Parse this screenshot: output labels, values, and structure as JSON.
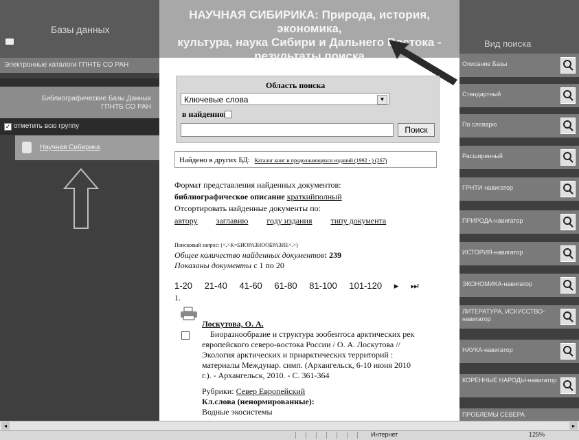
{
  "left": {
    "title": "Базы данных",
    "catalogs_link": "Электронные каталоги ГПНТБ СО РАН",
    "bibl_line1": "Библиографические Базы Данных",
    "bibl_line2": "ГПНТБ СО РАН",
    "group_label": "отметить всю группу",
    "db_item": "Научная Сибирика"
  },
  "header": {
    "line1": "НАУЧНАЯ СИБИРИКА: Природа, история, экономика,",
    "line2": "культура, наука Сибири и Дальнего Востока -",
    "line3": "результаты поиска"
  },
  "search": {
    "area_label": "Область поиска",
    "field_value": "Ключевые слова",
    "in_found_label": "в найденном",
    "query_value": "",
    "button": "Поиск"
  },
  "found_other": {
    "label": "Найдено в других БД:",
    "link": "Каталог книг и продолжающихся изданий (1992 - ) (267)"
  },
  "format": {
    "title": "Формат представления найденных документов:",
    "bold": "библиографическое описание",
    "short": "краткий",
    "full": "полный"
  },
  "sort": {
    "label": "Отсортировать найденные документы по:",
    "options": [
      "автору",
      "заглавию",
      "году издания",
      "типу документа"
    ]
  },
  "query": {
    "text": "Поисковый запрос: (<.>K=БИОРАЗНООБРАЗИЕ<.>)",
    "total_label": "Общее количество найденных документов",
    "total": ": 239",
    "shown_label": "Показаны документы",
    "shown": "с 1 по 20"
  },
  "pages": [
    "1-20",
    "21-40",
    "41-60",
    "61-80",
    "81-100",
    "101-120",
    "▸",
    "⏭"
  ],
  "record": {
    "num": "1.",
    "author": "Лоскутова, О. А.",
    "desc1": "Биоразнообразие и структура зообентоса арктических рек",
    "desc2": "европейского северо-востока России / О. А. Лоскутова //",
    "desc3": "Экология арктических и приарктических территорий :",
    "desc4": "материалы Междунар. симп. (Архангельск, 6-10 июня 2010",
    "desc5": "г.). - Архангельск, 2010. - С. 361-364",
    "rubric_label": "Рубрики:",
    "rubric": "Север Европейский",
    "kw_label": "Кл.слова (ненормированные):",
    "kw1": "Водные экосистемы"
  },
  "right": {
    "title": "Вид поиска",
    "items": [
      "Описание Базы",
      "Стандартный",
      "По словарю",
      "Расширенный",
      "ГРНТИ-навигатор",
      "ПРИРОДА-навигатор",
      "ИСТОРИЯ-навигатор",
      "ЭКОНОМИКА-навигатор",
      "ЛИТЕРАТУРА, ИСКУССТВО-навигатор",
      "НАУКА-навигатор",
      "КОРЕННЫЕ НАРОДЫ-навигатор",
      "ПРОБЛЕМЫ СЕВЕРА"
    ]
  },
  "status": {
    "zone": "Интернет",
    "zoom": "125%"
  }
}
